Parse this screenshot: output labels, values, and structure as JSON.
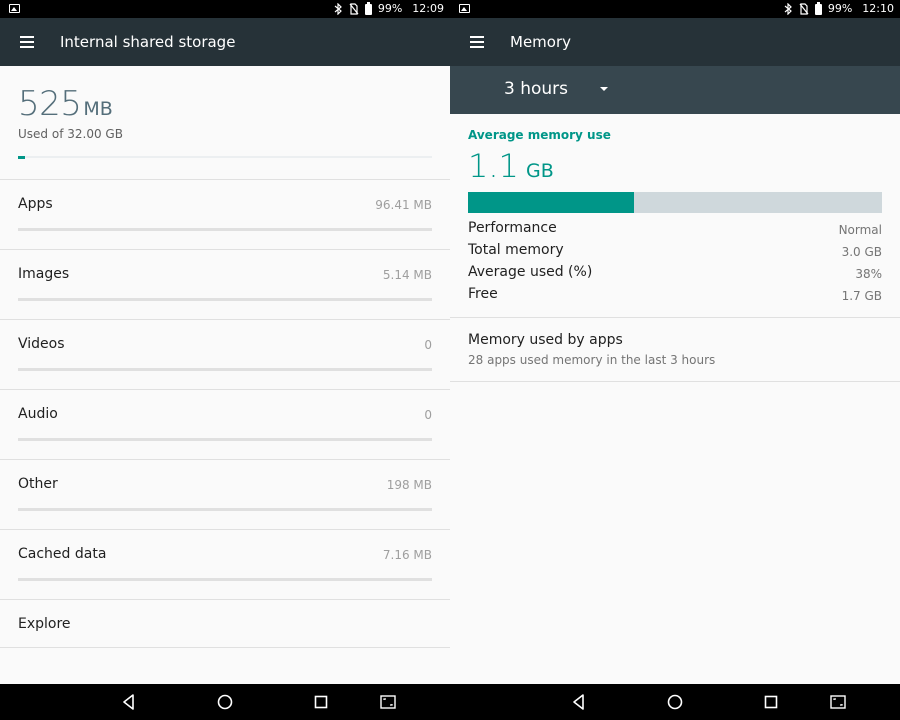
{
  "left": {
    "status": {
      "battery": "99%",
      "time": "12:09"
    },
    "title": "Internal shared storage",
    "used_value": "525",
    "used_unit": "MB",
    "used_of": "Used of 32.00 GB",
    "used_fraction": 0.016,
    "categories": [
      {
        "label": "Apps",
        "size": "96.41 MB"
      },
      {
        "label": "Images",
        "size": "5.14 MB"
      },
      {
        "label": "Videos",
        "size": "0"
      },
      {
        "label": "Audio",
        "size": "0"
      },
      {
        "label": "Other",
        "size": "198 MB"
      },
      {
        "label": "Cached data",
        "size": "7.16 MB"
      }
    ],
    "explore": "Explore"
  },
  "right": {
    "status": {
      "battery": "99%",
      "time": "12:10"
    },
    "title": "Memory",
    "period": "3 hours",
    "avg_heading": "Average memory use",
    "avg_value": "1.1",
    "avg_unit": "GB",
    "avg_fraction": 0.4,
    "stats": [
      {
        "label": "Performance",
        "value": "Normal"
      },
      {
        "label": "Total memory",
        "value": "3.0 GB"
      },
      {
        "label": "Average used (%)",
        "value": "38%"
      },
      {
        "label": "Free",
        "value": "1.7 GB"
      }
    ],
    "apps_title": "Memory used by apps",
    "apps_subtitle": "28 apps used memory in the last 3 hours"
  },
  "colors": {
    "accent": "#009688",
    "appbar": "#263238",
    "period_bar": "#37474f"
  },
  "icons": [
    "image-icon",
    "bluetooth-icon",
    "no-sim-icon",
    "battery-icon",
    "menu-icon",
    "dropdown-caret-icon",
    "back-icon",
    "home-icon",
    "recents-icon",
    "screenshot-icon"
  ]
}
